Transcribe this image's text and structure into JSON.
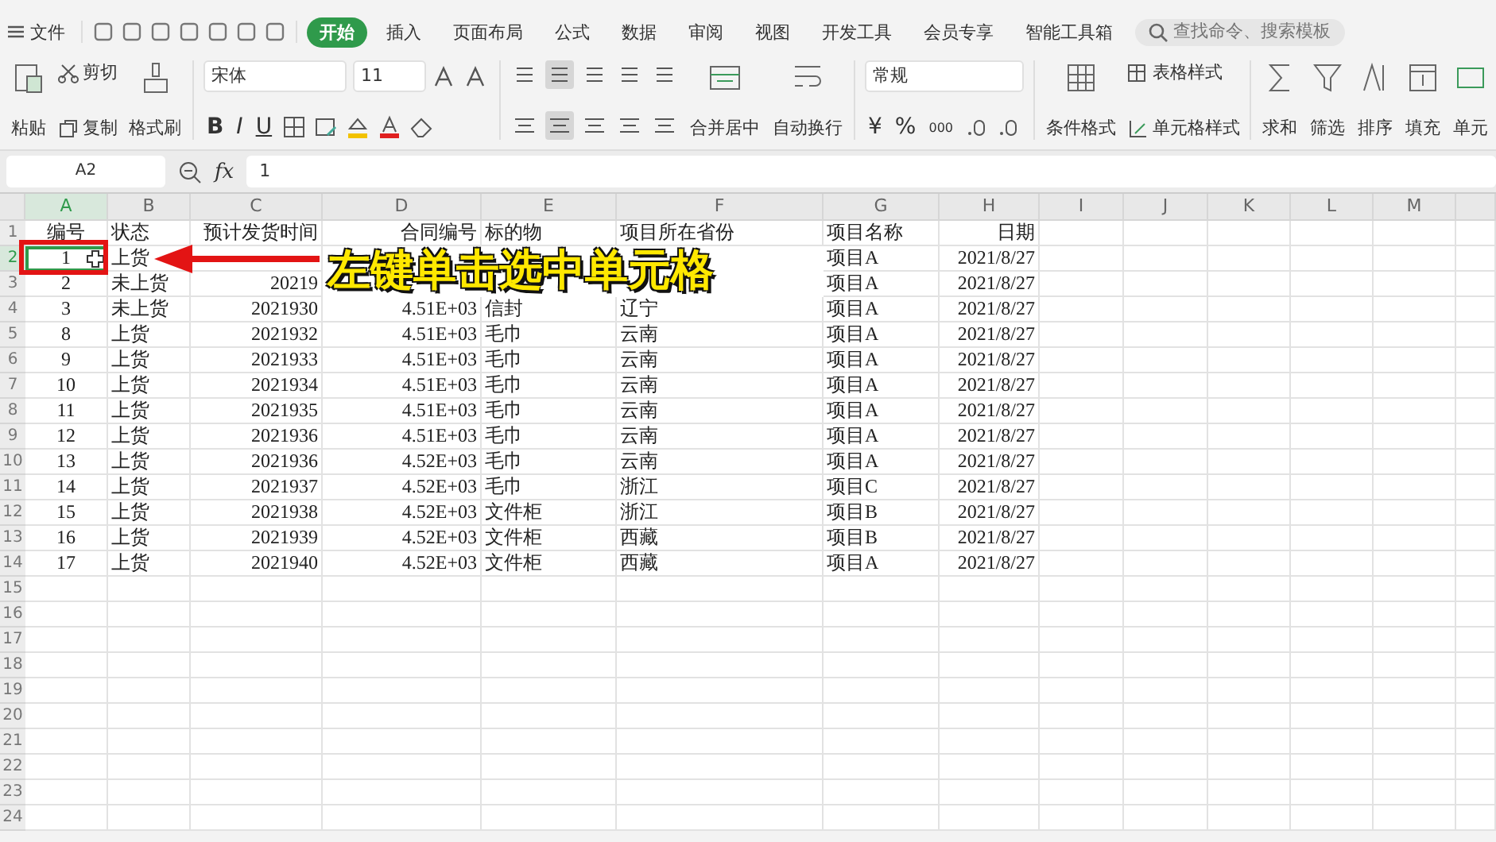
{
  "menu": {
    "label": "文件"
  },
  "tabs": [
    {
      "label": "开始",
      "selected": true
    },
    {
      "label": "插入",
      "selected": false
    },
    {
      "label": "页面布局",
      "selected": false
    },
    {
      "label": "公式",
      "selected": false
    },
    {
      "label": "数据",
      "selected": false
    },
    {
      "label": "审阅",
      "selected": false
    },
    {
      "label": "视图",
      "selected": false
    },
    {
      "label": "开发工具",
      "selected": false
    },
    {
      "label": "会员专享",
      "selected": false
    },
    {
      "label": "智能工具箱",
      "selected": false
    }
  ],
  "search": {
    "placeholder": "查找命令、搜索模板"
  },
  "ribbon": {
    "paste": "粘贴",
    "cut": "剪切",
    "copy": "复制",
    "format_painter": "格式刷",
    "font": "宋体",
    "font_size": "11",
    "bold": "B",
    "italic": "I",
    "underline": "U",
    "merge": "合并居中",
    "wrap": "自动换行",
    "number_format": "常规",
    "currency": "¥",
    "percent": "%",
    "thousands": "000",
    "conditional": "条件格式",
    "table_style": "表格样式",
    "cell_style": "单元格样式",
    "tools": [
      {
        "label": "求和"
      },
      {
        "label": "筛选"
      },
      {
        "label": "排序"
      },
      {
        "label": "填充"
      },
      {
        "label": "单元"
      }
    ]
  },
  "formula_bar": {
    "name_box": "A2",
    "fx": "fx",
    "value": "1"
  },
  "columns": [
    {
      "label": "A",
      "selected": true
    },
    {
      "label": "B",
      "selected": false
    },
    {
      "label": "C",
      "selected": false
    },
    {
      "label": "D",
      "selected": false
    },
    {
      "label": "E",
      "selected": false
    },
    {
      "label": "F",
      "selected": false
    },
    {
      "label": "G",
      "selected": false
    },
    {
      "label": "H",
      "selected": false
    },
    {
      "label": "I",
      "selected": false
    },
    {
      "label": "J",
      "selected": false
    },
    {
      "label": "K",
      "selected": false
    },
    {
      "label": "L",
      "selected": false
    },
    {
      "label": "M",
      "selected": false
    }
  ],
  "rows": [
    {
      "number": "1",
      "selected": false,
      "cells": {
        "A": "编号",
        "B": "状态",
        "C": "预计发货时间",
        "D": "合同编号",
        "E": "标的物",
        "F": "项目所在省份",
        "G": "项目名称",
        "H": "日期"
      }
    },
    {
      "number": "2",
      "selected": true,
      "cells": {
        "A": "1",
        "B": "上货",
        "G": "项目A",
        "H": "2021/8/27"
      }
    },
    {
      "number": "3",
      "selected": false,
      "cells": {
        "A": "2",
        "B": "未上货",
        "C": "20219",
        "G": "项目A",
        "H": "2021/8/27"
      }
    },
    {
      "number": "4",
      "selected": false,
      "cells": {
        "A": "3",
        "B": "未上货",
        "C": "2021930",
        "D": "4.51E+03",
        "E": "信封",
        "F": "辽宁",
        "G": "项目A",
        "H": "2021/8/27"
      }
    },
    {
      "number": "5",
      "selected": false,
      "cells": {
        "A": "8",
        "B": "上货",
        "C": "2021932",
        "D": "4.51E+03",
        "E": "毛巾",
        "F": "云南",
        "G": "项目A",
        "H": "2021/8/27"
      }
    },
    {
      "number": "6",
      "selected": false,
      "cells": {
        "A": "9",
        "B": "上货",
        "C": "2021933",
        "D": "4.51E+03",
        "E": "毛巾",
        "F": "云南",
        "G": "项目A",
        "H": "2021/8/27"
      }
    },
    {
      "number": "7",
      "selected": false,
      "cells": {
        "A": "10",
        "B": "上货",
        "C": "2021934",
        "D": "4.51E+03",
        "E": "毛巾",
        "F": "云南",
        "G": "项目A",
        "H": "2021/8/27"
      }
    },
    {
      "number": "8",
      "selected": false,
      "cells": {
        "A": "11",
        "B": "上货",
        "C": "2021935",
        "D": "4.51E+03",
        "E": "毛巾",
        "F": "云南",
        "G": "项目A",
        "H": "2021/8/27"
      }
    },
    {
      "number": "9",
      "selected": false,
      "cells": {
        "A": "12",
        "B": "上货",
        "C": "2021936",
        "D": "4.51E+03",
        "E": "毛巾",
        "F": "云南",
        "G": "项目A",
        "H": "2021/8/27"
      }
    },
    {
      "number": "10",
      "selected": false,
      "cells": {
        "A": "13",
        "B": "上货",
        "C": "2021936",
        "D": "4.52E+03",
        "E": "毛巾",
        "F": "云南",
        "G": "项目A",
        "H": "2021/8/27"
      }
    },
    {
      "number": "11",
      "selected": false,
      "cells": {
        "A": "14",
        "B": "上货",
        "C": "2021937",
        "D": "4.52E+03",
        "E": "毛巾",
        "F": "浙江",
        "G": "项目C",
        "H": "2021/8/27"
      }
    },
    {
      "number": "12",
      "selected": false,
      "cells": {
        "A": "15",
        "B": "上货",
        "C": "2021938",
        "D": "4.52E+03",
        "E": "文件柜",
        "F": "浙江",
        "G": "项目B",
        "H": "2021/8/27"
      }
    },
    {
      "number": "13",
      "selected": false,
      "cells": {
        "A": "16",
        "B": "上货",
        "C": "2021939",
        "D": "4.52E+03",
        "E": "文件柜",
        "F": "西藏",
        "G": "项目B",
        "H": "2021/8/27"
      }
    },
    {
      "number": "14",
      "selected": false,
      "cells": {
        "A": "17",
        "B": "上货",
        "C": "2021940",
        "D": "4.52E+03",
        "E": "文件柜",
        "F": "西藏",
        "G": "项目A",
        "H": "2021/8/27"
      }
    },
    {
      "number": "15",
      "selected": false,
      "cells": {}
    },
    {
      "number": "16",
      "selected": false,
      "cells": {}
    },
    {
      "number": "17",
      "selected": false,
      "cells": {}
    },
    {
      "number": "18",
      "selected": false,
      "cells": {}
    },
    {
      "number": "19",
      "selected": false,
      "cells": {}
    },
    {
      "number": "20",
      "selected": false,
      "cells": {}
    },
    {
      "number": "21",
      "selected": false,
      "cells": {}
    },
    {
      "number": "22",
      "selected": false,
      "cells": {}
    },
    {
      "number": "23",
      "selected": false,
      "cells": {}
    },
    {
      "number": "24",
      "selected": false,
      "cells": {}
    }
  ],
  "annotation": {
    "text": "左键单击选中单元格"
  }
}
